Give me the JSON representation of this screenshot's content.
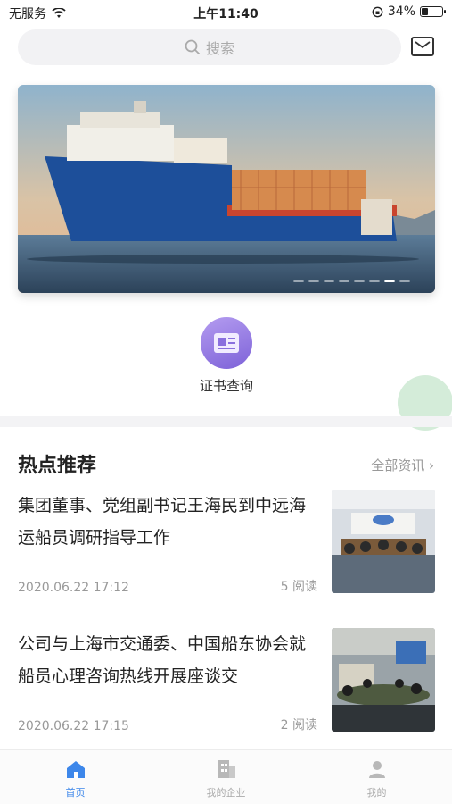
{
  "status": {
    "carrier": "无服务",
    "time": "上午11:40",
    "battery": "34%",
    "battery_level": 0.34
  },
  "search": {
    "placeholder": "搜索"
  },
  "banner": {
    "slides": 8,
    "active": 6
  },
  "quick": {
    "label": "证书查询"
  },
  "section": {
    "title": "热点推荐",
    "more": "全部资讯"
  },
  "news": [
    {
      "title": "集团董事、党组副书记王海民到中远海运船员调研指导工作",
      "date": "2020.06.22 17:12",
      "reads": "5 阅读"
    },
    {
      "title": "公司与上海市交通委、中国船东协会就船员心理咨询热线开展座谈交",
      "date": "2020.06.22 17:15",
      "reads": "2 阅读"
    }
  ],
  "tabs": [
    {
      "label": "首页",
      "icon": "home-icon",
      "active": true
    },
    {
      "label": "我的企业",
      "icon": "building-icon",
      "active": false
    },
    {
      "label": "我的",
      "icon": "person-icon",
      "active": false
    }
  ]
}
